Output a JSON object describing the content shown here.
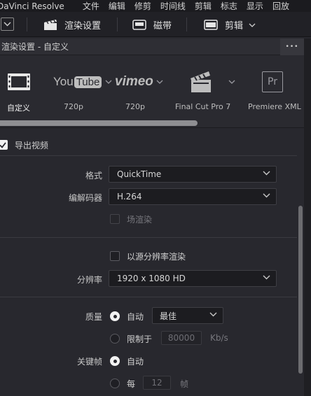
{
  "menubar": {
    "app": "DaVinci Resolve",
    "items": [
      "文件",
      "编辑",
      "修剪",
      "时间线",
      "剪辑",
      "标志",
      "显示",
      "回放"
    ]
  },
  "toolbar": {
    "render_settings": "渲染设置",
    "media_pool": "磁带",
    "clip": "剪辑"
  },
  "panel": {
    "title": "渲染设置 - 自定义",
    "more": "•••"
  },
  "presets": [
    {
      "name": "自定义",
      "icon": "film-strip-icon"
    },
    {
      "name": "720p",
      "icon": "youtube-logo",
      "logo_you": "You",
      "logo_tube": "Tube"
    },
    {
      "name": "720p",
      "icon": "vimeo-logo",
      "logo": "vimeo"
    },
    {
      "name": "Final Cut Pro 7",
      "icon": "clapperboard-icon"
    },
    {
      "name": "Premiere XML",
      "icon": "premiere-logo",
      "logo": "Pr"
    }
  ],
  "export_video": {
    "label": "导出视频",
    "checked": true
  },
  "format": {
    "label": "格式",
    "value": "QuickTime"
  },
  "codec": {
    "label": "编解码器",
    "value": "H.264"
  },
  "field_render": {
    "label": "场渲染",
    "checked": false
  },
  "source_res": {
    "label": "以源分辨率渲染",
    "checked": false
  },
  "resolution": {
    "label": "分辨率",
    "value": "1920 x 1080 HD"
  },
  "quality": {
    "label": "质量",
    "auto_label": "自动",
    "auto_value": "最佳",
    "limit_label": "限制于",
    "limit_value": "80000",
    "limit_unit": "Kb/s"
  },
  "keyframe": {
    "label": "关键帧",
    "auto_label": "自动",
    "every_label": "每",
    "every_value": "12",
    "every_unit": "帧"
  },
  "colors": {
    "accent": "#f2f2f2",
    "bg": "#28282e"
  }
}
